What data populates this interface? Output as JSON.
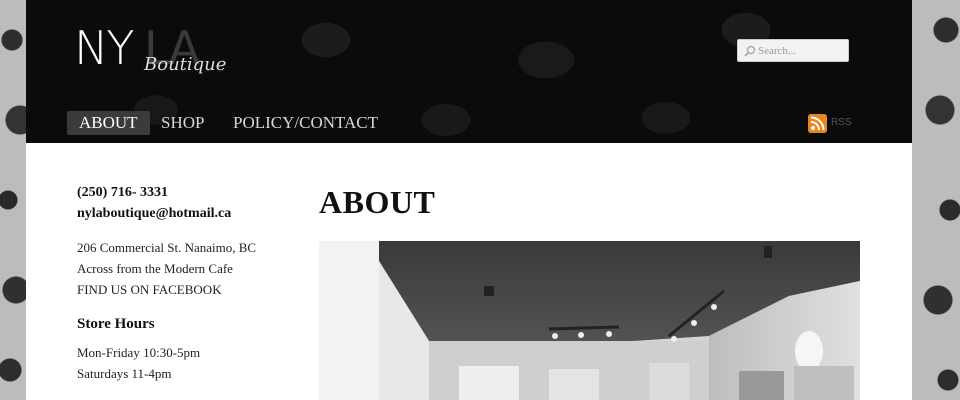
{
  "brand": {
    "logo_main": "NY",
    "logo_ghost": "LA",
    "logo_script": "Boutique"
  },
  "search": {
    "placeholder": "Search..."
  },
  "nav": {
    "items": [
      {
        "label": "ABOUT",
        "active": true
      },
      {
        "label": "SHOP",
        "active": false
      },
      {
        "label": "POLICY/CONTACT",
        "active": false
      }
    ]
  },
  "rss": {
    "label": "RSS",
    "icon": "rss-icon",
    "color": "#e8871e"
  },
  "sidebar": {
    "phone": "(250) 716- 3331",
    "email": "nylaboutique@hotmail.ca",
    "address_lines": [
      "206 Commercial St. Nanaimo, BC",
      "Across from the Modern Cafe",
      "FIND US ON FACEBOOK"
    ],
    "hours_title": "Store Hours",
    "hours_lines": [
      "Mon-Friday 10:30-5pm",
      "Saturdays 11-4pm"
    ]
  },
  "main": {
    "title": "ABOUT"
  },
  "colors": {
    "header_bg": "#0b0b0b",
    "page_bg": "#ffffff",
    "nav_active_bg": "#3b3b3b"
  }
}
